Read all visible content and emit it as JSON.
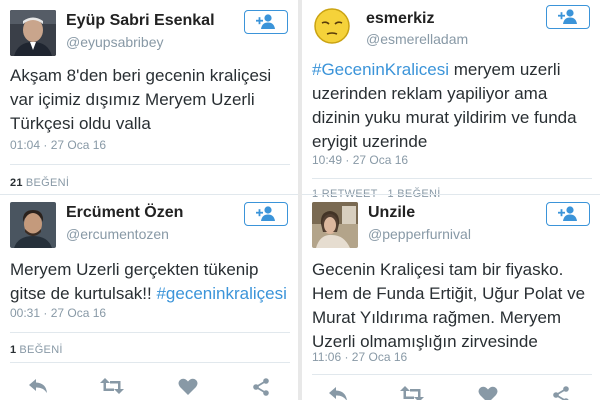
{
  "left": {
    "tweets": [
      {
        "name": "Eyüp Sabri Esenkal",
        "handle": "@eyupsabribey",
        "text": "Akşam 8'den beri gecenin kraliçesi var içimiz dışımız Meryem Uzerli Türkçesi oldu valla",
        "time": "01:04 · 27 Oca 16",
        "stat_count": "21",
        "stat_label": "BEĞENİ",
        "avatar_icon": "man-portrait-avatar"
      },
      {
        "name": "Ercüment Özen",
        "handle": "@ercumentozen",
        "text_plain": "Meryem Uzerli gerçekten tükenip gitse de kurtulsak!! ",
        "hashtag": "#geceninkraliçesi",
        "time": "00:31 · 27 Oca 16",
        "stat_count": "1",
        "stat_label": "BEĞENİ",
        "avatar_icon": "young-man-avatar"
      }
    ]
  },
  "right": {
    "tweets": [
      {
        "name": "esmerkiz",
        "handle": "@esmerelladam",
        "hashtag": "#GeceninKralicesi",
        "text_plain": " meryem uzerli uzerinden reklam yapiliyor ama dizinin yuku murat yildirim ve funda eryigit uzerinde",
        "time": "10:49 · 27 Oca 16",
        "stat_text": "1 RETWEET   1 BEĞENİ",
        "avatar_icon": "sleepy-emoji-avatar"
      },
      {
        "name": "Unzile",
        "handle": "@pepperfurnival",
        "text": "Gecenin Kraliçesi tam bir fiyasko. Hem de Funda Ertiğit, Uğur Polat ve Murat Yıldırıma rağmen. Meryem Uzerli olmamışlığın zirvesinde",
        "time": "11:06 · 27 Oca 16",
        "avatar_icon": "woman-photo-avatar"
      }
    ]
  },
  "icons": {
    "follow": "follow-user-icon",
    "reply": "reply-icon",
    "retweet": "retweet-icon",
    "like": "heart-icon",
    "share": "share-icon"
  },
  "colors": {
    "accent": "#3b94d9",
    "action_gray": "#8899a6",
    "text": "#292f33"
  }
}
